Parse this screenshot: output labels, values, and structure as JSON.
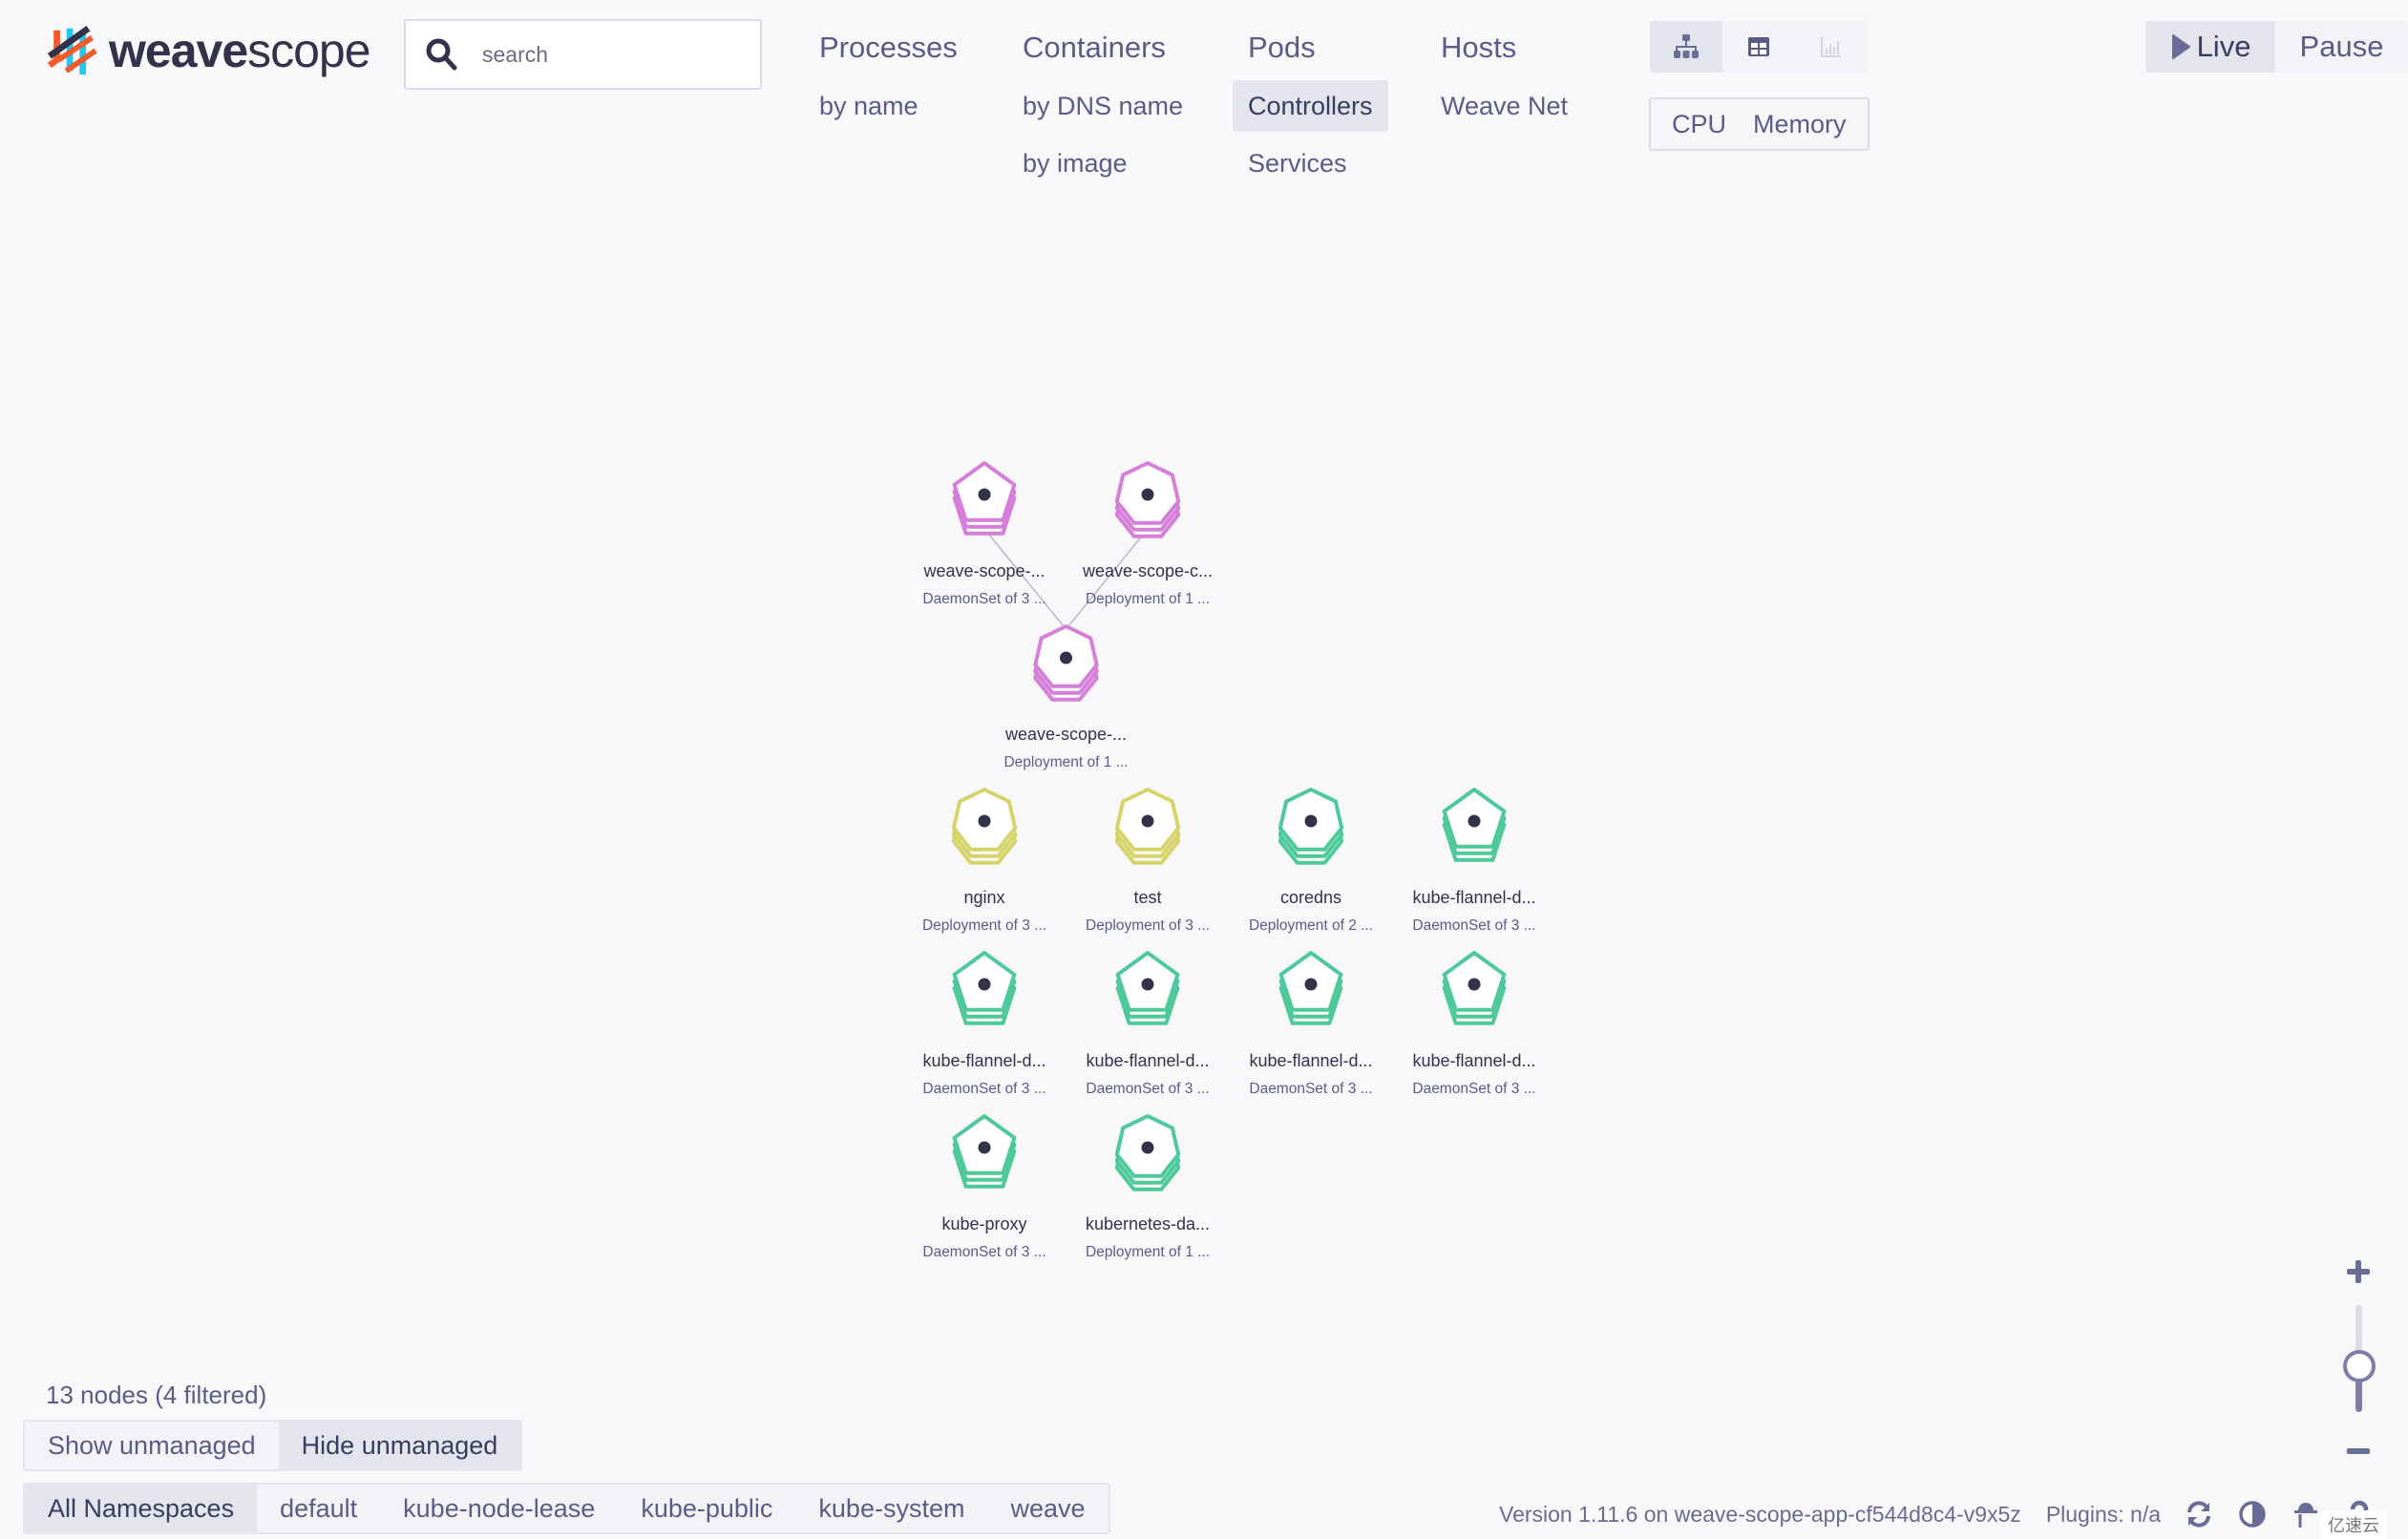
{
  "app": {
    "logo_bold": "weave",
    "logo_light": "scope"
  },
  "search": {
    "placeholder": "search",
    "value": ""
  },
  "nav": {
    "columns": [
      {
        "label": "Processes",
        "subitems": [
          {
            "label": "by name",
            "active": false
          }
        ]
      },
      {
        "label": "Containers",
        "subitems": [
          {
            "label": "by DNS name",
            "active": false
          },
          {
            "label": "by image",
            "active": false
          }
        ]
      },
      {
        "label": "Pods",
        "subitems": [
          {
            "label": "Controllers",
            "active": true
          },
          {
            "label": "Services",
            "active": false
          }
        ]
      },
      {
        "label": "Hosts",
        "subitems": [
          {
            "label": "Weave Net",
            "active": false
          }
        ]
      }
    ]
  },
  "view_modes": [
    {
      "name": "graph",
      "icon": "topology-graph-icon",
      "active": true
    },
    {
      "name": "table",
      "icon": "table-icon",
      "active": false
    },
    {
      "name": "resources",
      "icon": "bar-chart-icon",
      "active": false,
      "disabled": true
    }
  ],
  "metrics": {
    "cpu_label": "CPU",
    "memory_label": "Memory"
  },
  "live_pause": {
    "live_label": "Live",
    "pause_label": "Pause",
    "live_active": true
  },
  "graph": {
    "colors": {
      "weave": "#d67fd8",
      "default": "#d6d36a",
      "kube-system": "#4fc99a",
      "center_dot": "#32324b",
      "edge": "#b8b8c8"
    },
    "nodes": [
      {
        "id": "n1",
        "label": "weave-scope-...",
        "sublabel": "DaemonSet of 3 ...",
        "kind": "daemonset",
        "namespace": "weave",
        "col": 0,
        "row": 0
      },
      {
        "id": "n2",
        "label": "weave-scope-c...",
        "sublabel": "Deployment of 1 ...",
        "kind": "deployment",
        "namespace": "weave",
        "col": 1,
        "row": 0
      },
      {
        "id": "n3",
        "label": "weave-scope-...",
        "sublabel": "Deployment of 1 ...",
        "kind": "deployment",
        "namespace": "weave",
        "col": 0.5,
        "row": 1
      },
      {
        "id": "n4",
        "label": "nginx",
        "sublabel": "Deployment of 3 ...",
        "kind": "deployment",
        "namespace": "default",
        "col": 0,
        "row": 2
      },
      {
        "id": "n5",
        "label": "test",
        "sublabel": "Deployment of 3 ...",
        "kind": "deployment",
        "namespace": "default",
        "col": 1,
        "row": 2
      },
      {
        "id": "n6",
        "label": "coredns",
        "sublabel": "Deployment of 2 ...",
        "kind": "deployment",
        "namespace": "kube-system",
        "col": 2,
        "row": 2
      },
      {
        "id": "n7",
        "label": "kube-flannel-d...",
        "sublabel": "DaemonSet of 3 ...",
        "kind": "daemonset",
        "namespace": "kube-system",
        "col": 3,
        "row": 2
      },
      {
        "id": "n8",
        "label": "kube-flannel-d...",
        "sublabel": "DaemonSet of 3 ...",
        "kind": "daemonset",
        "namespace": "kube-system",
        "col": 0,
        "row": 3
      },
      {
        "id": "n9",
        "label": "kube-flannel-d...",
        "sublabel": "DaemonSet of 3 ...",
        "kind": "daemonset",
        "namespace": "kube-system",
        "col": 1,
        "row": 3
      },
      {
        "id": "n10",
        "label": "kube-flannel-d...",
        "sublabel": "DaemonSet of 3 ...",
        "kind": "daemonset",
        "namespace": "kube-system",
        "col": 2,
        "row": 3
      },
      {
        "id": "n11",
        "label": "kube-flannel-d...",
        "sublabel": "DaemonSet of 3 ...",
        "kind": "daemonset",
        "namespace": "kube-system",
        "col": 3,
        "row": 3
      },
      {
        "id": "n12",
        "label": "kube-proxy",
        "sublabel": "DaemonSet of 3 ...",
        "kind": "daemonset",
        "namespace": "kube-system",
        "col": 0,
        "row": 4
      },
      {
        "id": "n13",
        "label": "kubernetes-da...",
        "sublabel": "Deployment of 1 ...",
        "kind": "deployment",
        "namespace": "kube-system",
        "col": 1,
        "row": 4
      }
    ],
    "edges": [
      [
        "n1",
        "n3"
      ],
      [
        "n2",
        "n3"
      ]
    ]
  },
  "status": {
    "node_count": "13 nodes (4 filtered)"
  },
  "unmanaged": {
    "show_label": "Show unmanaged",
    "hide_label": "Hide unmanaged",
    "active": "hide"
  },
  "namespaces": {
    "items": [
      "All Namespaces",
      "default",
      "kube-node-lease",
      "kube-public",
      "kube-system",
      "weave"
    ],
    "active": "All Namespaces"
  },
  "footer": {
    "version": "Version 1.11.6 on weave-scope-app-cf544d8c4-v9x5z",
    "plugins": "Plugins: n/a",
    "icons": [
      "refresh-icon",
      "contrast-icon",
      "troubleshoot-icon",
      "help-icon"
    ]
  },
  "zoom": {
    "level_fraction": 0.43
  },
  "watermark": "亿速云"
}
